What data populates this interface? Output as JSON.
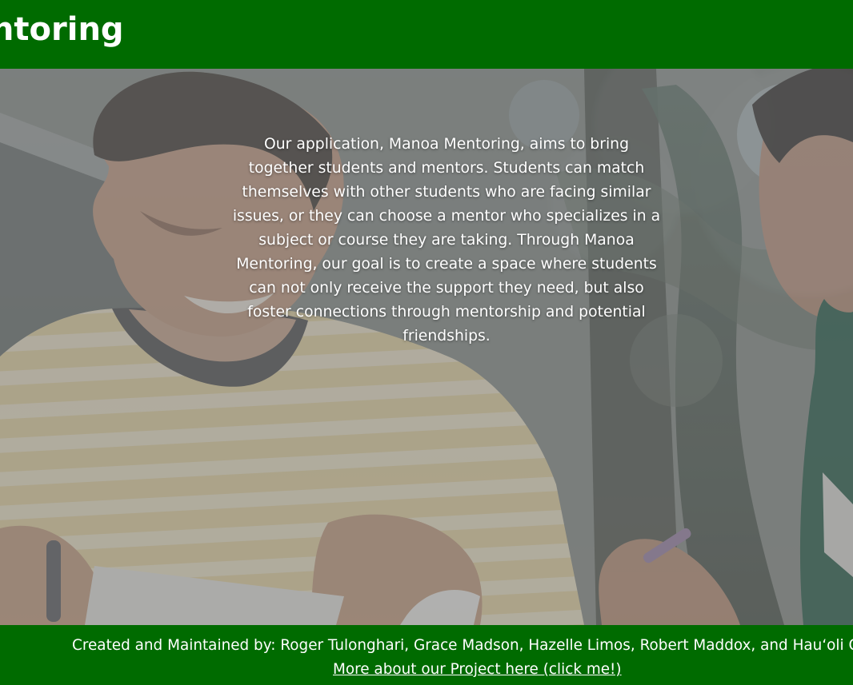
{
  "header": {
    "brand_text": "Mentoring"
  },
  "hero": {
    "mission": "Our application, Manoa Mentoring, aims to bring together students and mentors. Students can match themselves with other students who are facing similar issues, or they can choose a mentor who specializes in a subject or course they are taking. Through Manoa Mentoring, our goal is to create a space where students can not only receive the support they need, but also foster connections through mentorship and potential friendships."
  },
  "footer": {
    "credits": "Created and Maintained by: Roger Tulonghari, Grace Madson, Hazelle Limos, Robert Maddox, and Hau‘oli O’Bri",
    "project_link": "More about our Project here (click me!)"
  },
  "colors": {
    "header_bg": "#006b00",
    "footer_bg": "#006b00",
    "text": "#ffffff"
  }
}
